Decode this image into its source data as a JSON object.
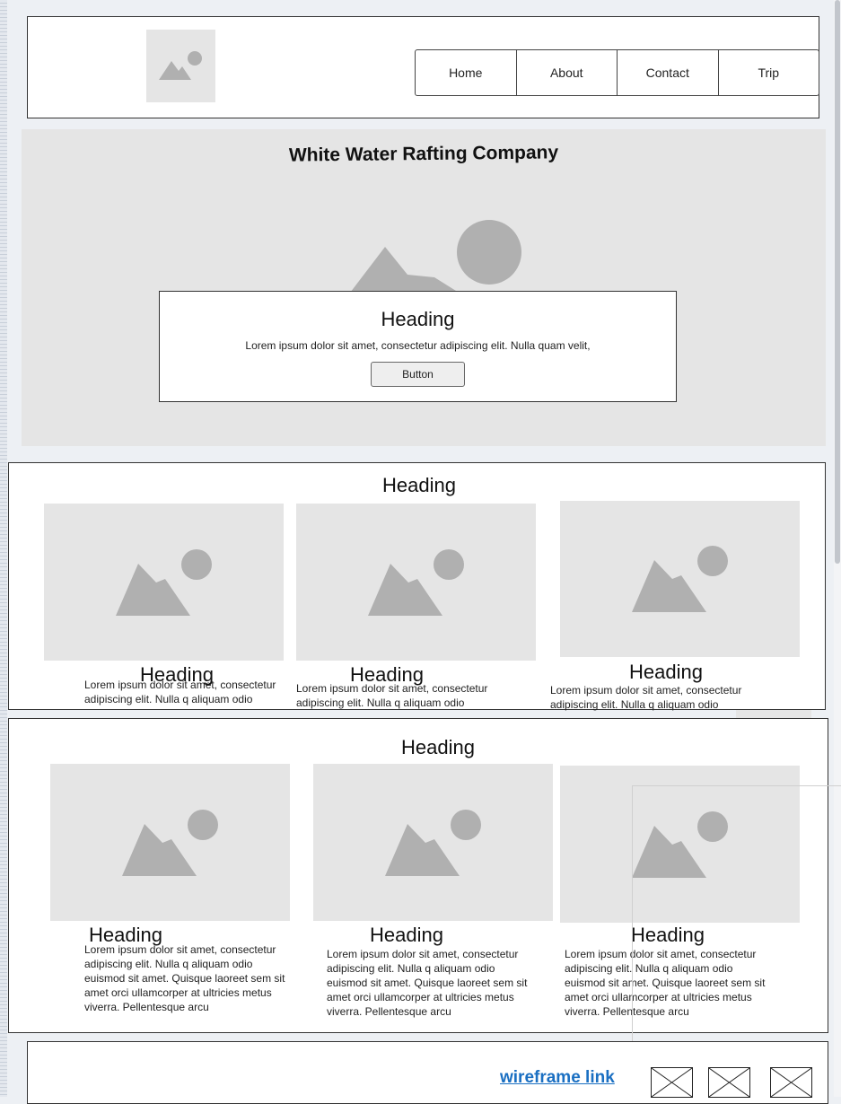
{
  "header": {
    "nav": [
      "Home",
      "About",
      "Contact",
      "Trip"
    ]
  },
  "hero": {
    "title": "White Water Rafting Company",
    "callout": {
      "heading": "Heading",
      "text": "Lorem ipsum dolor sit amet, consectetur adipiscing elit. Nulla quam velit,",
      "button": "Button"
    }
  },
  "section1": {
    "heading": "Heading",
    "cards": [
      {
        "heading": "Heading",
        "text": "Lorem ipsum dolor sit amet, consectetur adipiscing elit. Nulla q aliquam odio"
      },
      {
        "heading": "Heading",
        "text": "Lorem ipsum dolor sit amet, consectetur adipiscing elit. Nulla q aliquam odio"
      },
      {
        "heading": "Heading",
        "text": "Lorem ipsum dolor sit amet, consectetur adipiscing elit. Nulla q aliquam odio"
      }
    ]
  },
  "section2": {
    "heading": "Heading",
    "cards": [
      {
        "heading": "Heading",
        "text": "Lorem ipsum dolor sit amet, consectetur adipiscing elit. Nulla q aliquam odio euismod sit amet. Quisque laoreet sem sit amet orci ullamcorper at ultricies metus viverra. Pellentesque arcu"
      },
      {
        "heading": "Heading",
        "text": "Lorem ipsum dolor sit amet, consectetur adipiscing elit. Nulla q aliquam odio euismod sit amet. Quisque laoreet sem sit amet orci ullamcorper at ultricies metus viverra. Pellentesque arcu"
      },
      {
        "heading": "Heading",
        "text": "Lorem ipsum dolor sit amet, consectetur adipiscing elit. Nulla q aliquam odio euismod sit amet. Quisque laoreet sem sit amet orci ullamcorper at ultricies metus viverra. Pellentesque arcu"
      }
    ]
  },
  "footer": {
    "link": "wireframe link",
    "icons": [
      "image-placeholder-icon",
      "image-placeholder-icon",
      "image-placeholder-icon"
    ]
  }
}
